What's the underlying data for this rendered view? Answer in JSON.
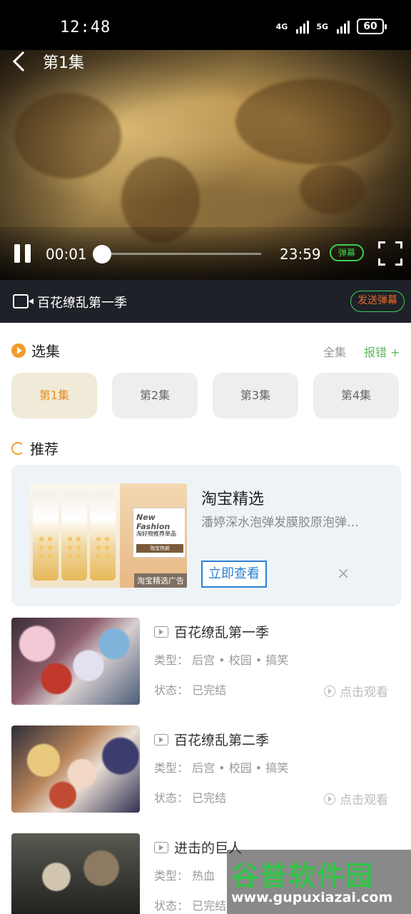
{
  "status_bar": {
    "time": "12:48",
    "net1": "4G",
    "net2": "5G",
    "battery": "60"
  },
  "video": {
    "title": "第1集",
    "current_time": "00:01",
    "total_time": "23:59",
    "danmu_label": "弹幕",
    "progress_fraction": 0.0
  },
  "info_bar": {
    "title": "百花缭乱第一季",
    "send_danmu": "发送弹幕"
  },
  "episodes": {
    "heading": "选集",
    "all_label": "全集",
    "report_label": "报错 +",
    "items": [
      "第1集",
      "第2集",
      "第3集",
      "第4集"
    ],
    "active_index": 0
  },
  "recommend": {
    "heading": "推荐"
  },
  "ad": {
    "title": "淘宝精选",
    "description": "潘婷深水泡弹发膜胶原泡弹…",
    "button": "立即查看",
    "badge": "淘宝精选广告",
    "image_title": "New Fashion",
    "image_sub": "淘好物推荐单品",
    "image_tag": "淘宝热款",
    "close": "×"
  },
  "anime_list": [
    {
      "title": "百花缭乱第一季",
      "type": "类型： 后宫 • 校园 • 搞笑",
      "status": "状态： 已完结",
      "watch": "点击观看"
    },
    {
      "title": "百花缭乱第二季",
      "type": "类型： 后宫 • 校园 • 搞笑",
      "status": "状态： 已完结",
      "watch": "点击观看"
    },
    {
      "title": "进击的巨人",
      "type": "类型： 热血",
      "status": "状态： 已完结",
      "watch": ""
    }
  ],
  "watermark": {
    "title": "谷普软件园",
    "url": "www.gupuxiazai.com"
  },
  "colors": {
    "accent": "#f29b2c",
    "danmu_green": "#39d353",
    "ad_blue": "#2d7fd1",
    "info_bar_bg": "#1f2128"
  }
}
